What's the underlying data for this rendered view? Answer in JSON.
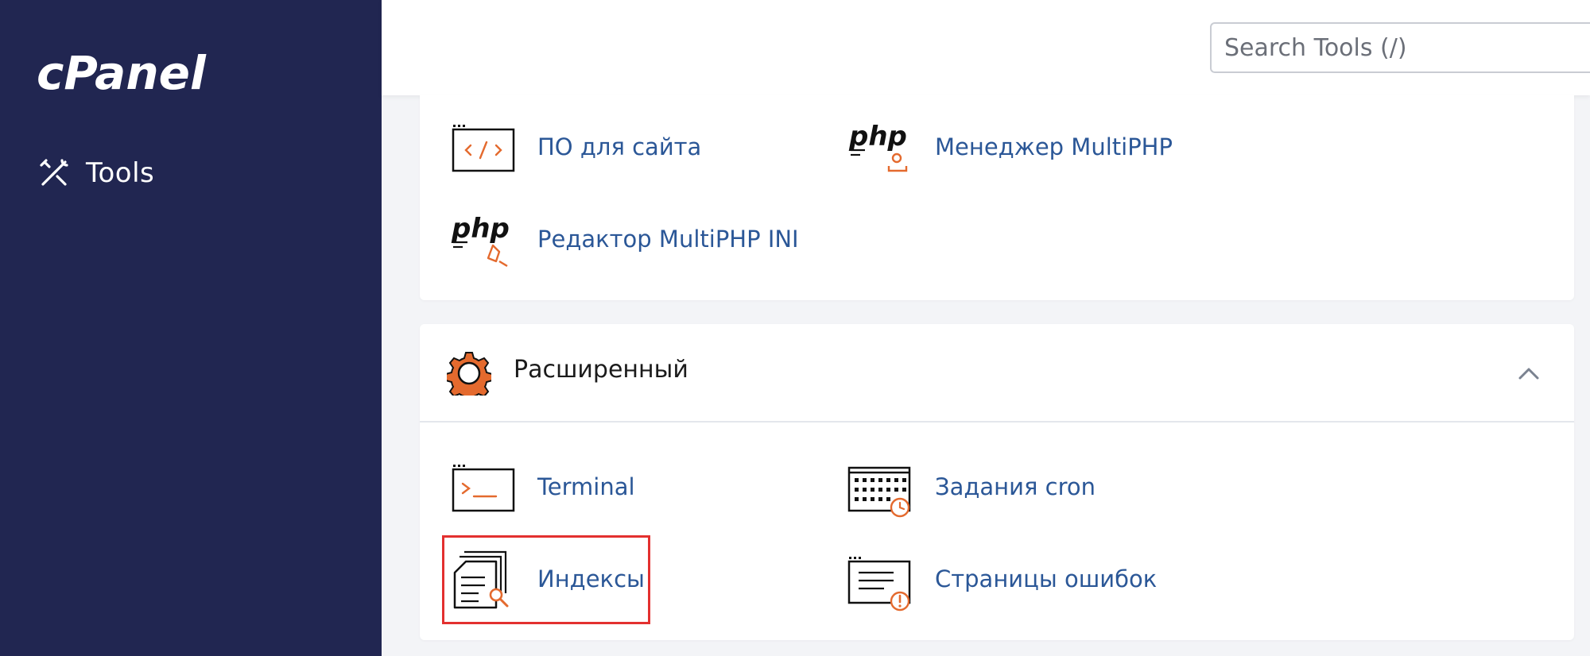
{
  "brand": {
    "logo_text": "cPanel"
  },
  "sidebar": {
    "tools_label": "Tools"
  },
  "search": {
    "placeholder": "Search Tools (/)"
  },
  "software_section": {
    "items": [
      {
        "label": "ПО для сайта",
        "icon": "code-window-icon"
      },
      {
        "label": "Менеджер MultiPHP",
        "icon": "php-manager-icon"
      },
      {
        "label": "Редактор MultiPHP INI",
        "icon": "php-editor-icon"
      }
    ]
  },
  "advanced_section": {
    "title": "Расширенный",
    "icon": "gear-icon",
    "items": [
      {
        "label": "Terminal",
        "icon": "terminal-icon"
      },
      {
        "label": "Задания cron",
        "icon": "cron-calendar-icon"
      },
      {
        "label": "Индексы",
        "icon": "indexes-icon"
      },
      {
        "label": "Страницы ошибок",
        "icon": "error-pages-icon"
      }
    ]
  },
  "colors": {
    "sidebar": "#212651",
    "accent": "#e46a2e",
    "link": "#2b5797",
    "highlight": "#e3302f"
  }
}
